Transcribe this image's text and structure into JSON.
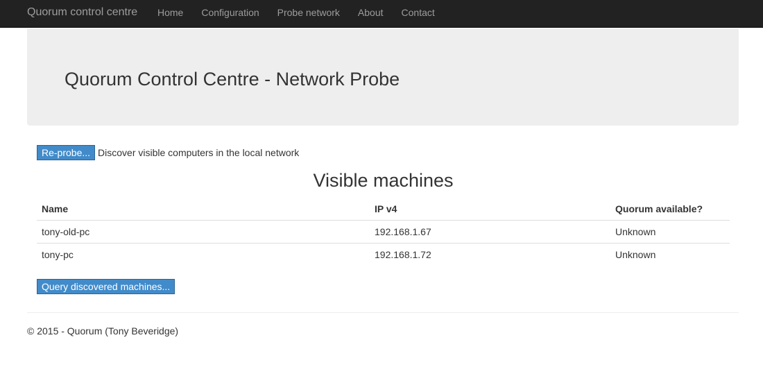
{
  "navbar": {
    "brand": "Quorum control centre",
    "links": [
      "Home",
      "Configuration",
      "Probe network",
      "About",
      "Contact"
    ]
  },
  "jumbotron": {
    "title": "Quorum Control Centre - Network Probe"
  },
  "probe": {
    "button_label": "Re-probe...",
    "description": "Discover visible computers in the local network"
  },
  "machines": {
    "title": "Visible machines",
    "columns": [
      "Name",
      "IP v4",
      "Quorum available?"
    ],
    "rows": [
      {
        "name": "tony-old-pc",
        "ip": "192.168.1.67",
        "quorum": "Unknown"
      },
      {
        "name": "tony-pc",
        "ip": "192.168.1.72",
        "quorum": "Unknown"
      }
    ]
  },
  "query": {
    "button_label": "Query discovered machines..."
  },
  "footer": {
    "text": "© 2015 - Quorum (Tony Beveridge)"
  },
  "colors": {
    "navbar_bg": "#222222",
    "nav_text": "#9d9d9d",
    "jumbotron_bg": "#eeeeee",
    "button_bg": "#428bca"
  }
}
